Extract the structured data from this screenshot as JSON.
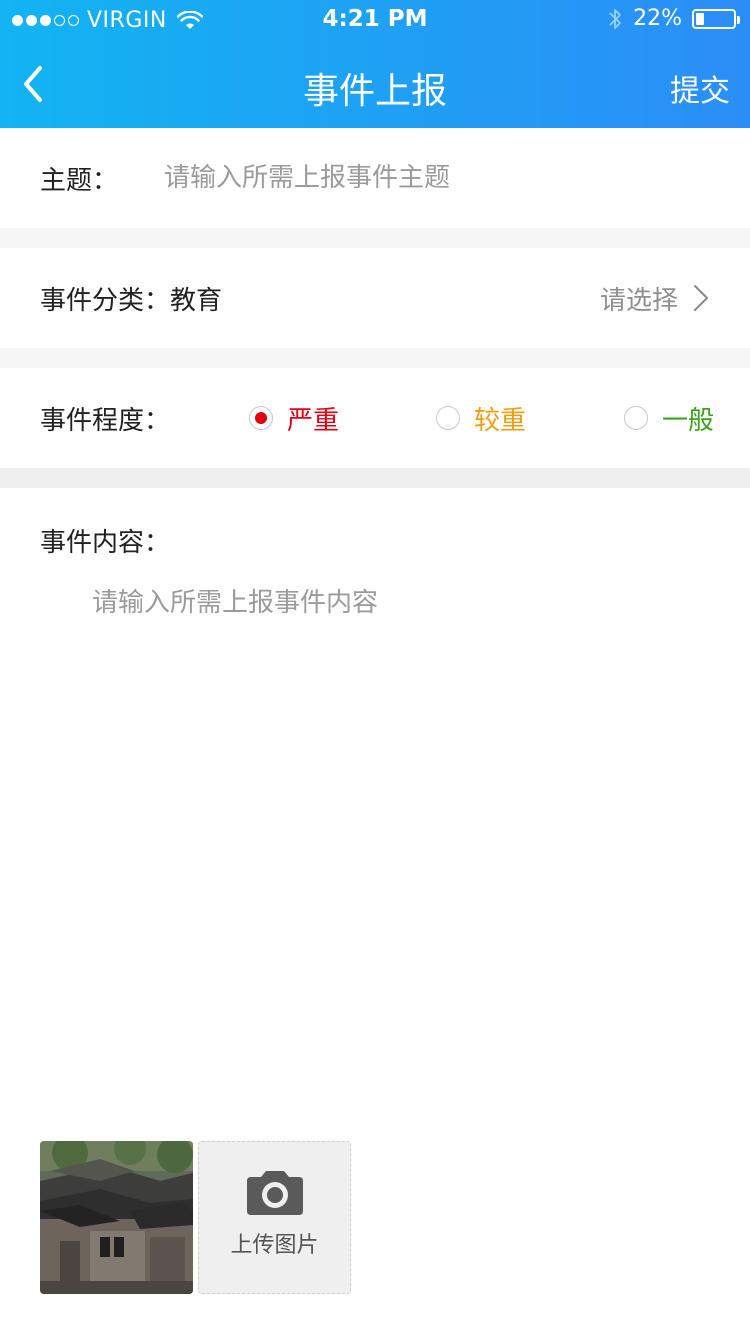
{
  "status_bar": {
    "signal_dots_filled": 3,
    "signal_dots_total": 5,
    "carrier": "VIRGIN",
    "time": "4:21 PM",
    "battery_text": "22%",
    "battery_level": 0.22
  },
  "nav": {
    "title": "事件上报",
    "submit_label": "提交",
    "back_icon": "chevron-left-icon"
  },
  "subject": {
    "label": "主题：",
    "placeholder": "请输入所需上报事件主题",
    "value": ""
  },
  "category": {
    "label": "事件分类：教育",
    "choose_label": "请选择"
  },
  "severity": {
    "label": "事件程度：",
    "options": [
      {
        "label": "严重",
        "selected": true,
        "color": "#e00012"
      },
      {
        "label": "较重",
        "selected": false,
        "color": "#f39c12"
      },
      {
        "label": "一般",
        "selected": false,
        "color": "#3aa31d"
      }
    ]
  },
  "content": {
    "label": "事件内容：",
    "placeholder": "请输入所需上报事件内容",
    "value": ""
  },
  "attachments": {
    "upload_label": "上传图片",
    "upload_icon": "camera-icon"
  },
  "colors": {
    "header_start": "#12b4f1",
    "header_end": "#2b8ef7"
  }
}
